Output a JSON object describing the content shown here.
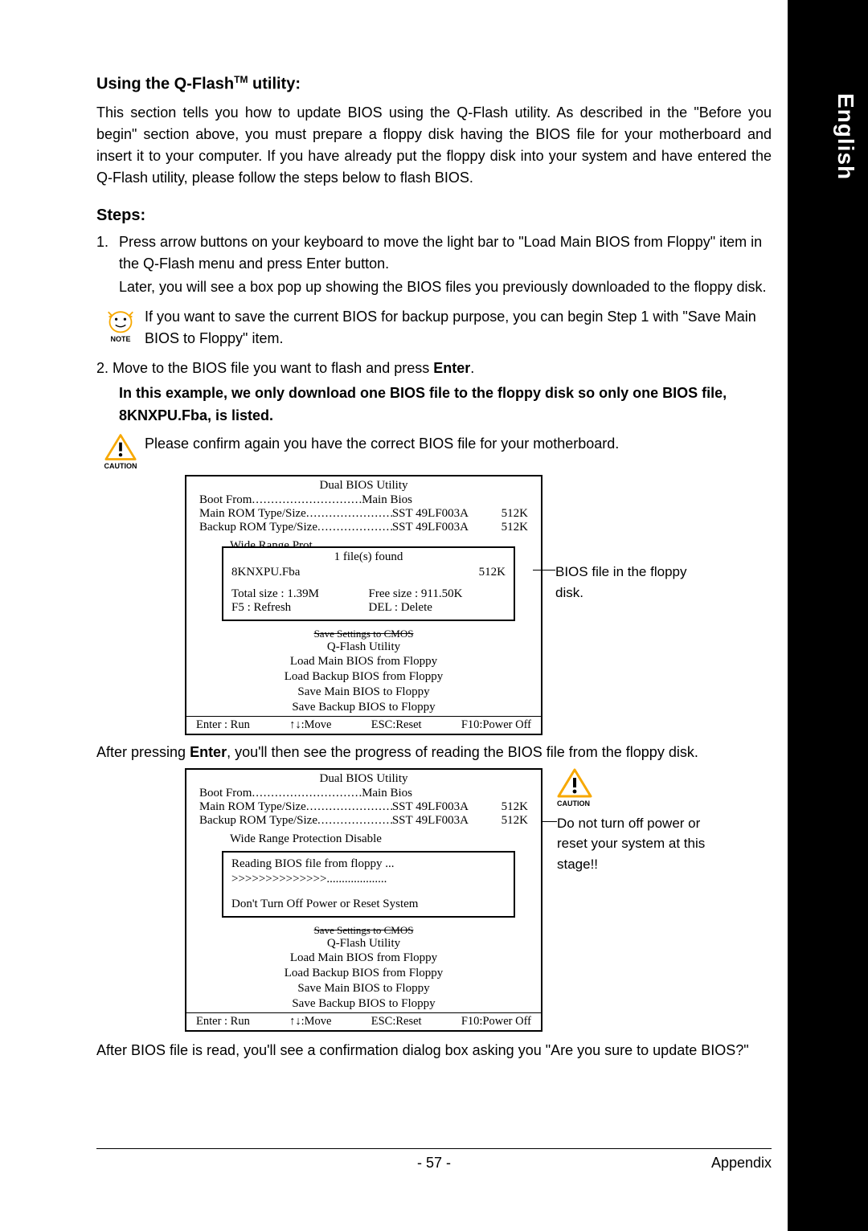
{
  "sideTab": "English",
  "heading1_pre": "Using the Q-Flash",
  "heading1_tm": "TM",
  "heading1_post": " utility:",
  "intro": "This section tells you how to update BIOS using the Q-Flash utility. As described in the \"Before you begin\" section above, you must prepare a floppy disk having the BIOS file for your motherboard and insert it to your computer. If you have already put the floppy disk into your system and have entered the Q-Flash utility, please follow the steps below to flash BIOS.",
  "stepsHeading": "Steps:",
  "step1_num": "1.",
  "step1_a": "Press arrow buttons on your keyboard to move the light bar to \"Load Main BIOS from Floppy\" item in the Q-Flash menu and press Enter button.",
  "step1_b": "Later, you will see a box pop up showing the BIOS files you previously downloaded to the floppy disk.",
  "noteLabel": "NOTE",
  "noteText": "If you want to save the current BIOS for backup purpose, you can begin Step 1 with \"Save Main BIOS to Floppy\" item.",
  "step2_pre": "2. Move to the BIOS file you want to flash and press ",
  "step2_bold": "Enter",
  "step2_post": ".",
  "boldExample": "In this example, we only download one BIOS file to the floppy disk so only one BIOS file, 8KNXPU.Fba, is listed.",
  "cautionLabel": "CAUTION",
  "cautionText": "Please confirm again you have the correct BIOS file for your motherboard.",
  "bios": {
    "title": "Dual BIOS Utility",
    "bootLabel": "Boot From",
    "bootVal": "Main Bios",
    "mainRomLabel": "Main ROM Type/Size",
    "mainRomVal": "SST 49LF003A",
    "mainRomSize": "512K",
    "backupRomLabel": "Backup ROM Type/Size",
    "backupRomVal": "SST 49LF003A",
    "backupRomSize": "512K",
    "wideRange": "Wide Range Protection    Disable",
    "wideRangeCut": "Wide Range Prot",
    "filesFound": "1 file(s) found",
    "fileName": "8KNXPU.Fba",
    "fileSize": "512K",
    "totalSize": "Total size : 1.39M",
    "freeSize": "Free size : 911.50K",
    "f5": "F5 : Refresh",
    "del": "DEL : Delete",
    "cutoffText": "Save Settings to CMOS",
    "qflashTitle": "Q-Flash Utility",
    "menu1": "Load Main BIOS from Floppy",
    "menu2": "Load Backup BIOS from Floppy",
    "menu3": "Save Main BIOS to Floppy",
    "menu4": "Save Backup BIOS to Floppy",
    "cmdEnter": "Enter : Run",
    "cmdMove": "↑↓:Move",
    "cmdEsc": "ESC:Reset",
    "cmdF10": "F10:Power Off",
    "reading": "Reading BIOS file from floppy ...",
    "progress": ">>>>>>>>>>>>>>....................",
    "dontTurn": "Don't Turn Off Power or Reset System"
  },
  "annot1": "BIOS file in the floppy disk.",
  "annot2": "Do not turn off power or reset your system at this stage!!",
  "afterEnter_pre": "After pressing ",
  "afterEnter_bold": "Enter",
  "afterEnter_post": ", you'll then see the progress of reading the BIOS file from the floppy disk.",
  "afterRead": "After BIOS file is read, you'll see a confirmation dialog box asking you \"Are you sure to update BIOS?\"",
  "footerPage": "- 57 -",
  "footerRight": "Appendix"
}
